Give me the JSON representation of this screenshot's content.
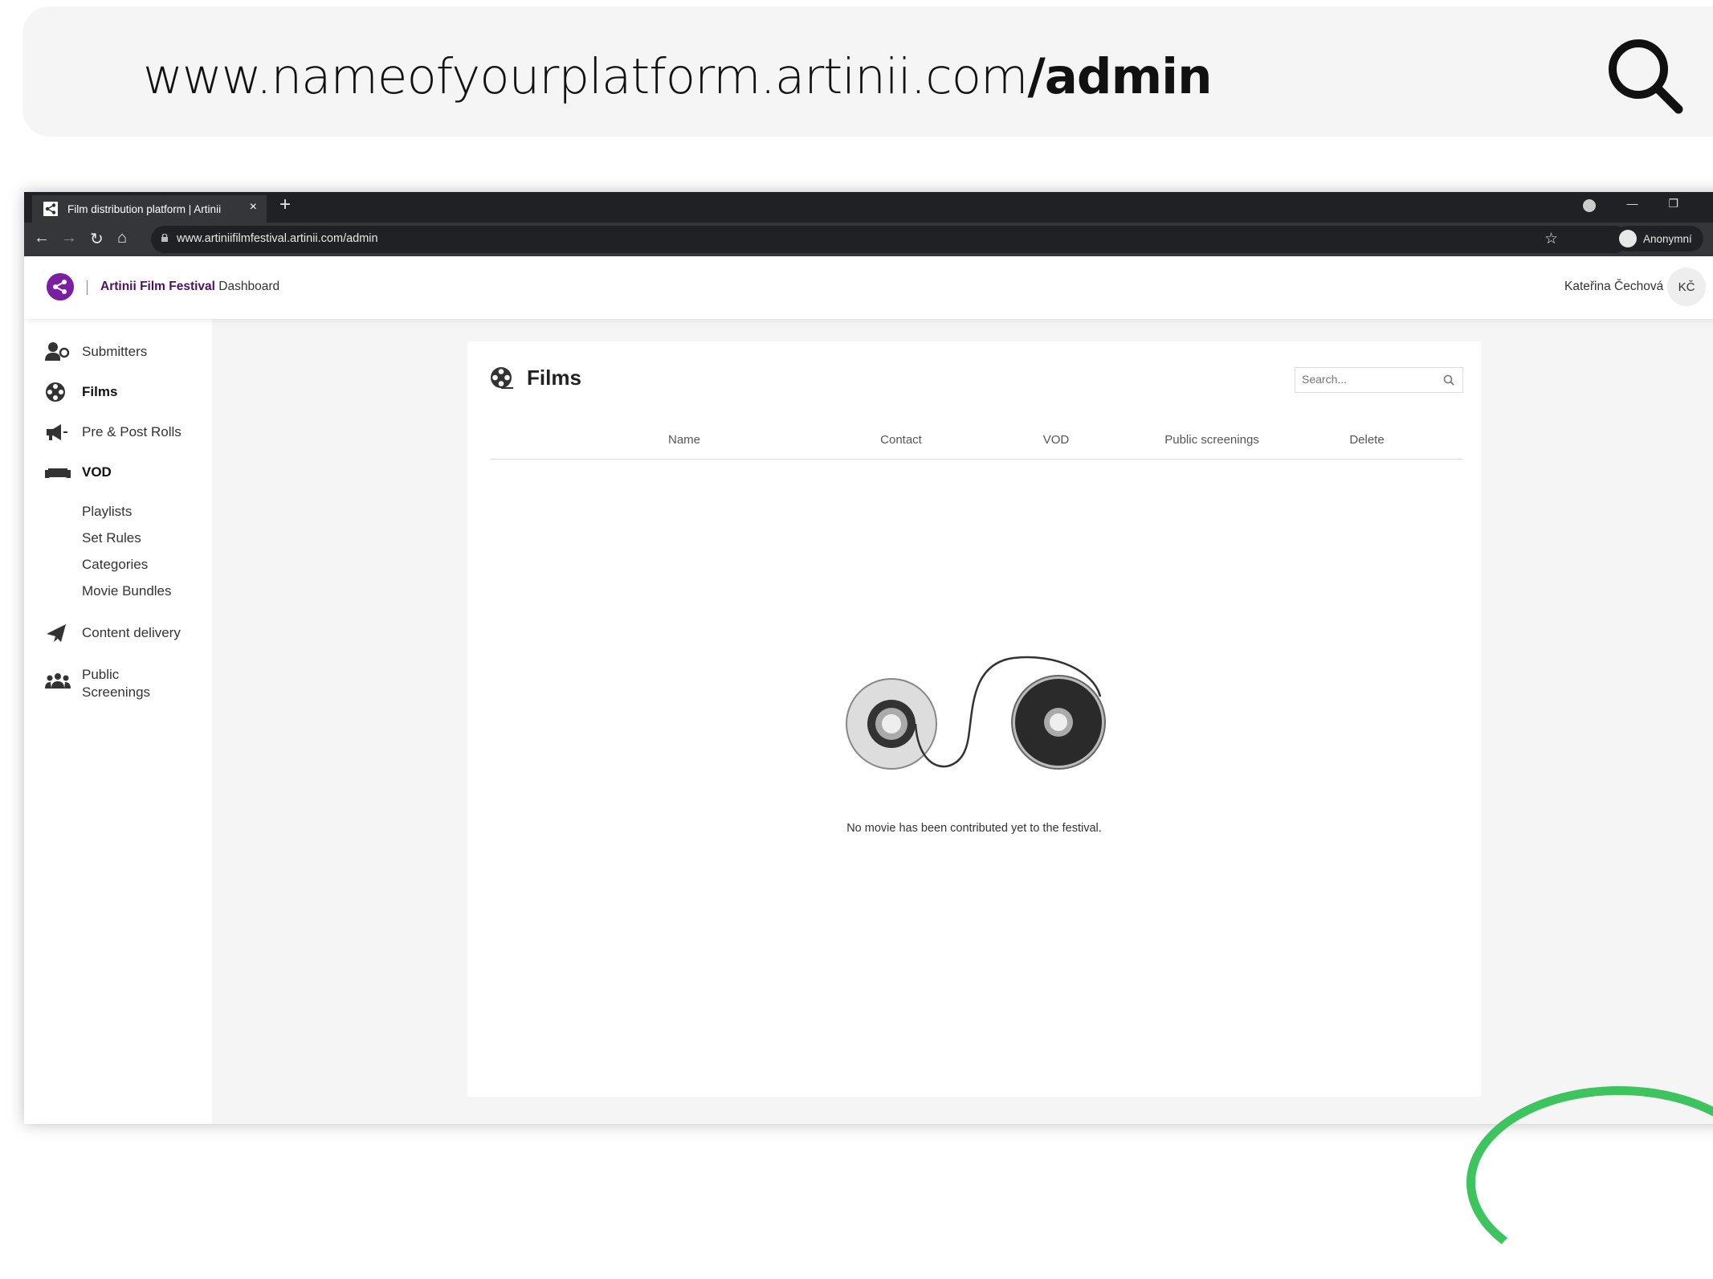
{
  "banner": {
    "url_prefix": "www.nameofyourplatform.artinii.com",
    "url_suffix": "/admin",
    "search_icon": "magnifier-icon"
  },
  "browser": {
    "tab_title": "Film distribution platform | Artinii",
    "tab_close": "×",
    "new_tab": "+",
    "address": "www.artiniifilmfestival.artinii.com/admin",
    "profile_label": "Anonymní"
  },
  "app": {
    "brand_name": "Artinii Film Festival",
    "brand_section": "Dashboard",
    "user_name": "Kateřina Čechová",
    "user_initials": "KČ",
    "brand_color": "#7b1fa2"
  },
  "sidebar": {
    "submitters": "Submitters",
    "films": "Films",
    "pre_post_rolls": "Pre & Post Rolls",
    "vod": "VOD",
    "vod_sub": [
      "Playlists",
      "Set Rules",
      "Categories",
      "Movie Bundles"
    ],
    "content_delivery": "Content delivery",
    "public_screenings_1": "Public",
    "public_screenings_2": "Screenings"
  },
  "films_panel": {
    "title": "Films",
    "search_placeholder": "Search...",
    "columns": [
      "Name",
      "Contact",
      "VOD",
      "Public screenings",
      "Delete"
    ],
    "empty_message": "No movie has been contributed yet to the festival."
  }
}
